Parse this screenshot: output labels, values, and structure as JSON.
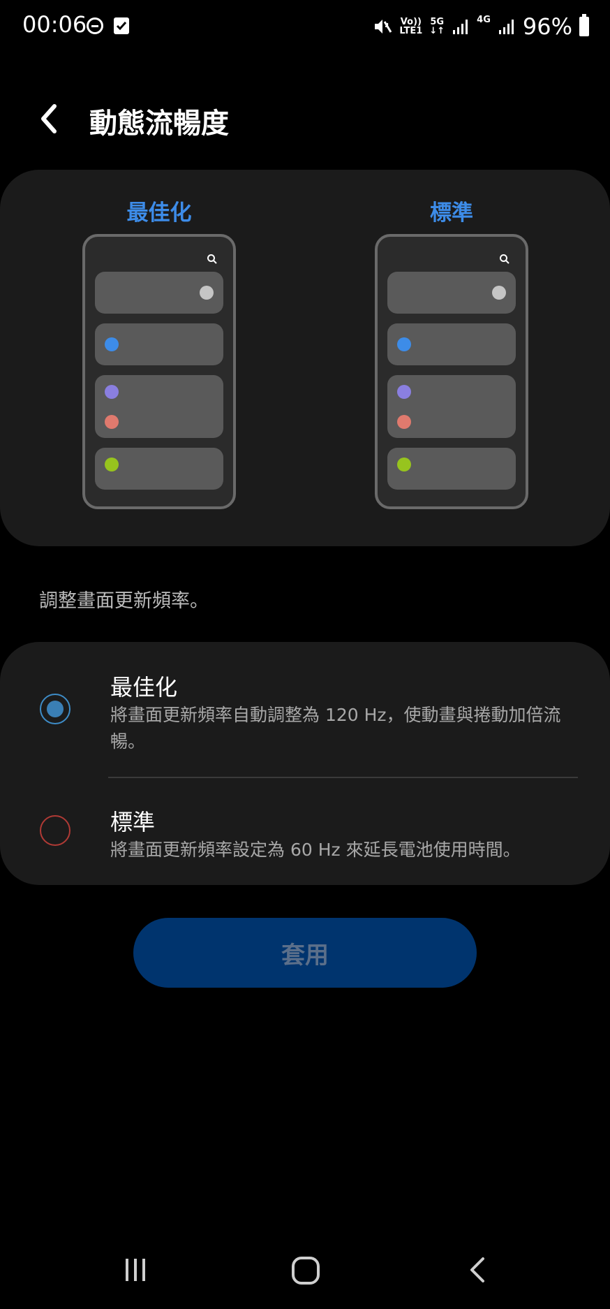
{
  "status_bar": {
    "time": "00:06",
    "volte_top": "Vo))",
    "volte_bottom": "LTE1",
    "net_5g": "5G",
    "net_5g_arrows": "↓↑",
    "net_4g": "4G",
    "battery": "96%",
    "icons": [
      "dnd-icon",
      "task-check-icon",
      "mute-icon",
      "signal-icon",
      "signal-icon",
      "battery-icon"
    ]
  },
  "header": {
    "title": "動態流暢度"
  },
  "preview": {
    "left_label": "最佳化",
    "right_label": "標準",
    "dot_colors": [
      "#c5c5c5",
      "#3d8ce8",
      "#8a7fe0",
      "#e07a6e",
      "#97c41e"
    ]
  },
  "description": "調整畫面更新頻率。",
  "options": [
    {
      "title": "最佳化",
      "description": "將畫面更新頻率自動調整為 120 Hz，使動畫與捲動加倍流暢。",
      "selected": true
    },
    {
      "title": "標準",
      "description": "將畫面更新頻率設定為 60 Hz 來延長電池使用時間。",
      "selected": false
    }
  ],
  "apply_label": "套用",
  "colors": {
    "accent": "#3d8ce8",
    "card_bg": "#1b1b1b",
    "button_bg": "#00346e"
  }
}
